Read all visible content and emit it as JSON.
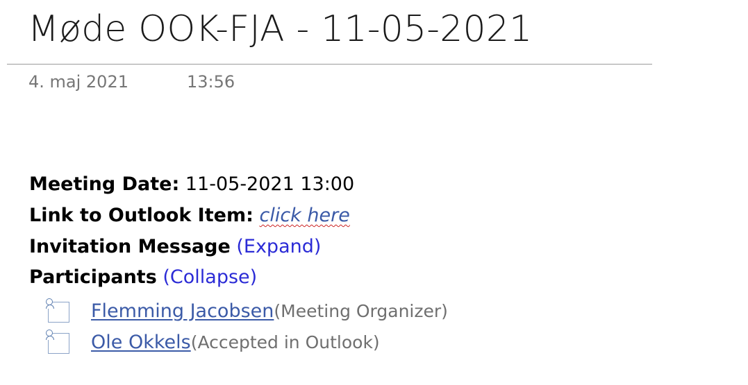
{
  "page": {
    "title": "Møde OOK-FJA - 11-05-2021",
    "date": "4. maj 2021",
    "time": "13:56"
  },
  "meeting": {
    "date_label": "Meeting Date:",
    "date_value": "11-05-2021 13:00",
    "outlook_label": "Link to Outlook Item:",
    "outlook_link": "click here",
    "invitation_label": "Invitation Message",
    "invitation_toggle": "(Expand)",
    "participants_label": "Participants",
    "participants_toggle": "(Collapse)"
  },
  "participants": [
    {
      "name": "Flemming Jacobsen ",
      "status": "(Meeting Organizer)",
      "icon": "contact-card-icon"
    },
    {
      "name": "Ole Okkels ",
      "status": "(Accepted in Outlook)",
      "icon": "contact-card-icon"
    }
  ],
  "colors": {
    "link": "#3b5aa7",
    "toggle": "#2b2bd6",
    "muted": "#767676",
    "spellcheck": "#cc2222"
  }
}
